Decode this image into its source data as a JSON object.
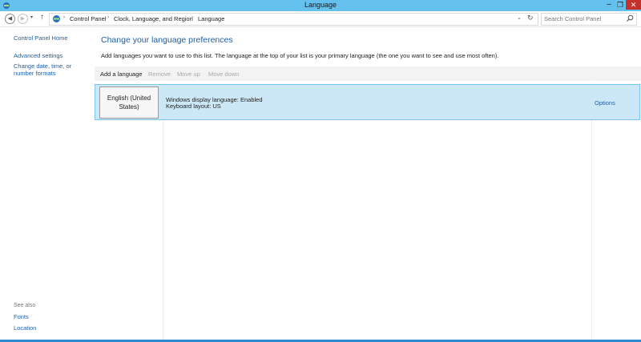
{
  "window": {
    "title": "Language",
    "minimize_glyph": "–",
    "maximize_glyph": "❐",
    "close_glyph": "✕"
  },
  "navigation": {
    "back_icon": "back-arrow-icon",
    "forward_icon": "forward-arrow-icon",
    "recent_glyph": "▾",
    "up_glyph": "↑",
    "breadcrumb": [
      "Control Panel",
      "Clock, Language, and Region",
      "Language"
    ],
    "separator": "›",
    "dropdown_glyph": "⌄",
    "refresh_glyph": "↻",
    "search_placeholder": "Search Control Panel"
  },
  "sidebar": {
    "home": "Control Panel Home",
    "links": [
      "Advanced settings",
      "Change date, time, or number formats"
    ],
    "see_also_label": "See also",
    "see_also_links": [
      "Fonts",
      "Location"
    ]
  },
  "main": {
    "heading": "Change your language preferences",
    "description": "Add languages you want to use to this list. The language at the top of your list is your primary language (the one you want to see and use most often).",
    "toolbar": {
      "add": "Add a language",
      "remove": "Remove",
      "move_up": "Move up",
      "move_down": "Move down"
    },
    "languages": [
      {
        "name": "English (United States)",
        "display_status": "Windows display language: Enabled",
        "keyboard": "Keyboard layout: US",
        "options": "Options"
      }
    ]
  },
  "colors": {
    "titlebar": "#64c1ee",
    "close": "#c7312b",
    "link": "#1f5fa6",
    "selected_row": "#cce8f6"
  }
}
